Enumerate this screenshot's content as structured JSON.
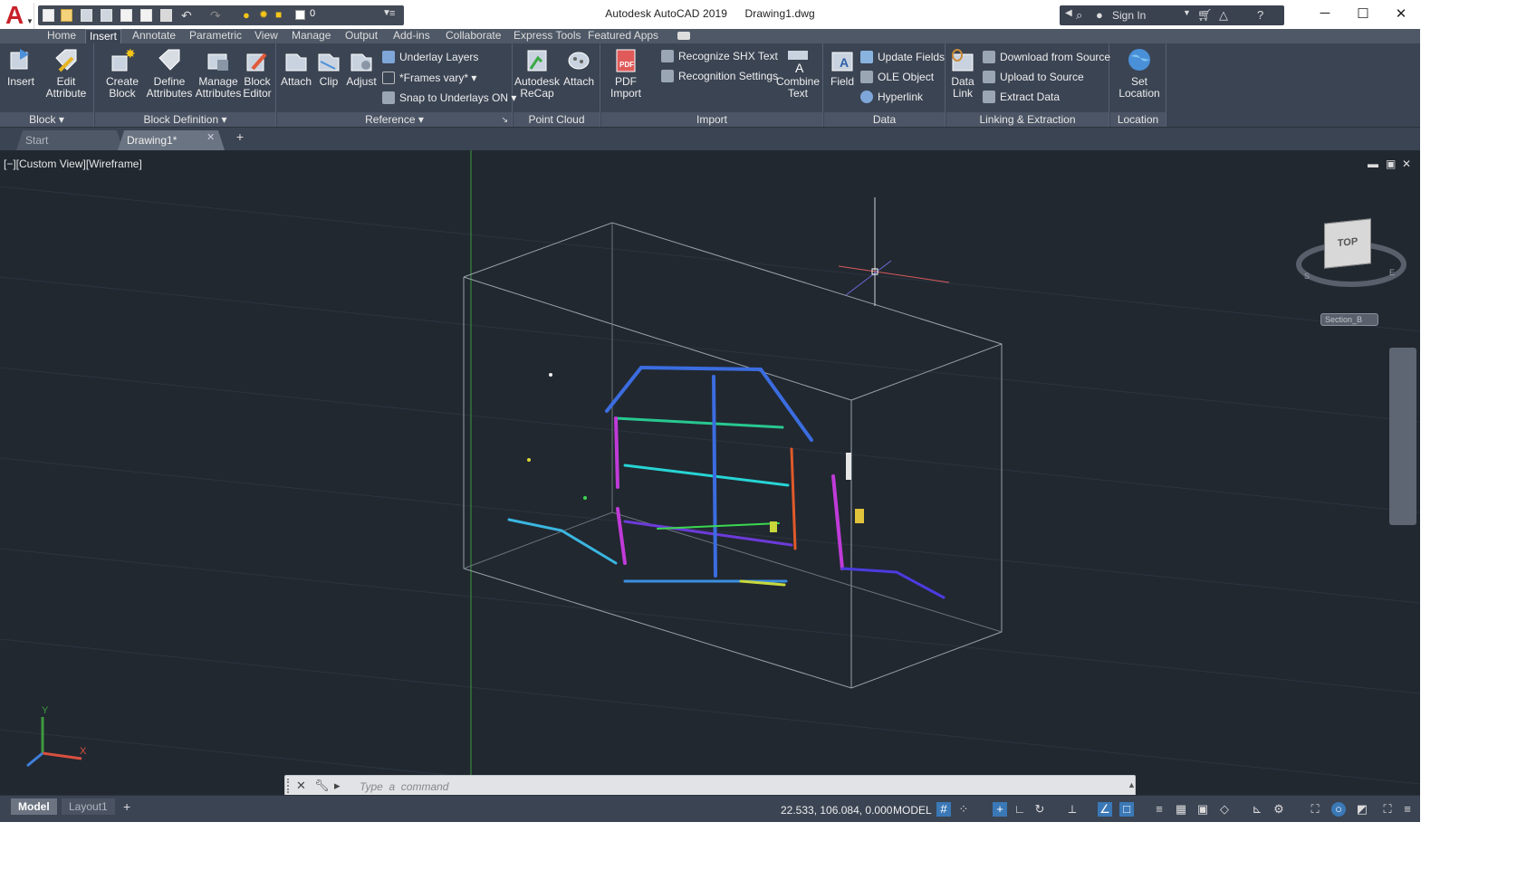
{
  "window": {
    "app_name": "Autodesk AutoCAD 2019",
    "file_name": "Drawing1.dwg",
    "layer_current": "0",
    "signin_label": "Sign In"
  },
  "ribbon_tabs": [
    "Home",
    "Insert",
    "Annotate",
    "Parametric",
    "View",
    "Manage",
    "Output",
    "Add-ins",
    "Collaborate",
    "Express Tools",
    "Featured Apps"
  ],
  "active_tab": "Insert",
  "panels": {
    "block": {
      "title": "Block",
      "buttons": [
        {
          "label": "Insert",
          "icon": "insert-block-icon"
        },
        {
          "label": "Edit Attribute",
          "icon": "edit-attribute-icon"
        }
      ]
    },
    "block_definition": {
      "title": "Block Definition",
      "buttons": [
        {
          "label": "Create Block",
          "icon": "create-block-icon"
        },
        {
          "label": "Define Attributes",
          "icon": "define-attributes-icon"
        },
        {
          "label": "Manage Attributes",
          "icon": "manage-attributes-icon"
        },
        {
          "label": "Block Editor",
          "icon": "block-editor-icon"
        }
      ]
    },
    "reference": {
      "title": "Reference",
      "buttons": [
        {
          "label": "Attach",
          "icon": "attach-icon"
        },
        {
          "label": "Clip",
          "icon": "clip-icon"
        },
        {
          "label": "Adjust",
          "icon": "adjust-icon"
        }
      ],
      "small": [
        "Underlay Layers",
        "*Frames vary*",
        "Snap to Underlays ON"
      ]
    },
    "point_cloud": {
      "title": "Point Cloud",
      "buttons": [
        {
          "label": "Autodesk ReCap",
          "icon": "recap-icon"
        },
        {
          "label": "Attach",
          "icon": "point-cloud-attach-icon"
        }
      ]
    },
    "import": {
      "title": "Import",
      "buttons": [
        {
          "label": "PDF Import",
          "icon": "pdf-import-icon"
        },
        {
          "label": "Combine Text",
          "icon": "combine-text-icon"
        }
      ],
      "small": [
        "Recognize SHX Text",
        "Recognition Settings"
      ]
    },
    "data": {
      "title": "Data",
      "buttons": [
        {
          "label": "Field",
          "icon": "field-icon"
        }
      ],
      "small": [
        "Update Fields",
        "OLE Object",
        "Hyperlink"
      ]
    },
    "linking": {
      "title": "Linking & Extraction",
      "buttons": [
        {
          "label": "Data Link",
          "icon": "data-link-icon"
        }
      ],
      "small": [
        "Download from Source",
        "Upload to Source",
        "Extract  Data"
      ]
    },
    "location": {
      "title": "Location",
      "buttons": [
        {
          "label": "Set Location",
          "icon": "globe-icon"
        }
      ]
    }
  },
  "doc_tabs": [
    "Start",
    "Drawing1*"
  ],
  "viewport": {
    "label": "[−][Custom View][Wireframe]",
    "viewcube_face": "TOP",
    "compass": [
      "S",
      "E"
    ],
    "ucs_name": "Section_B",
    "axes": [
      "X",
      "Y"
    ]
  },
  "command": {
    "placeholder": "Type  a  command"
  },
  "status": {
    "layout_tabs": [
      "Model",
      "Layout1"
    ],
    "coordinates": "22.533, 106.084, 0.000",
    "space": "MODEL"
  },
  "colors": {
    "viewport_bg": "#212830",
    "ribbon_bg": "#3b4453",
    "accent": "#3a78b6",
    "logo_red": "#c8202a"
  }
}
